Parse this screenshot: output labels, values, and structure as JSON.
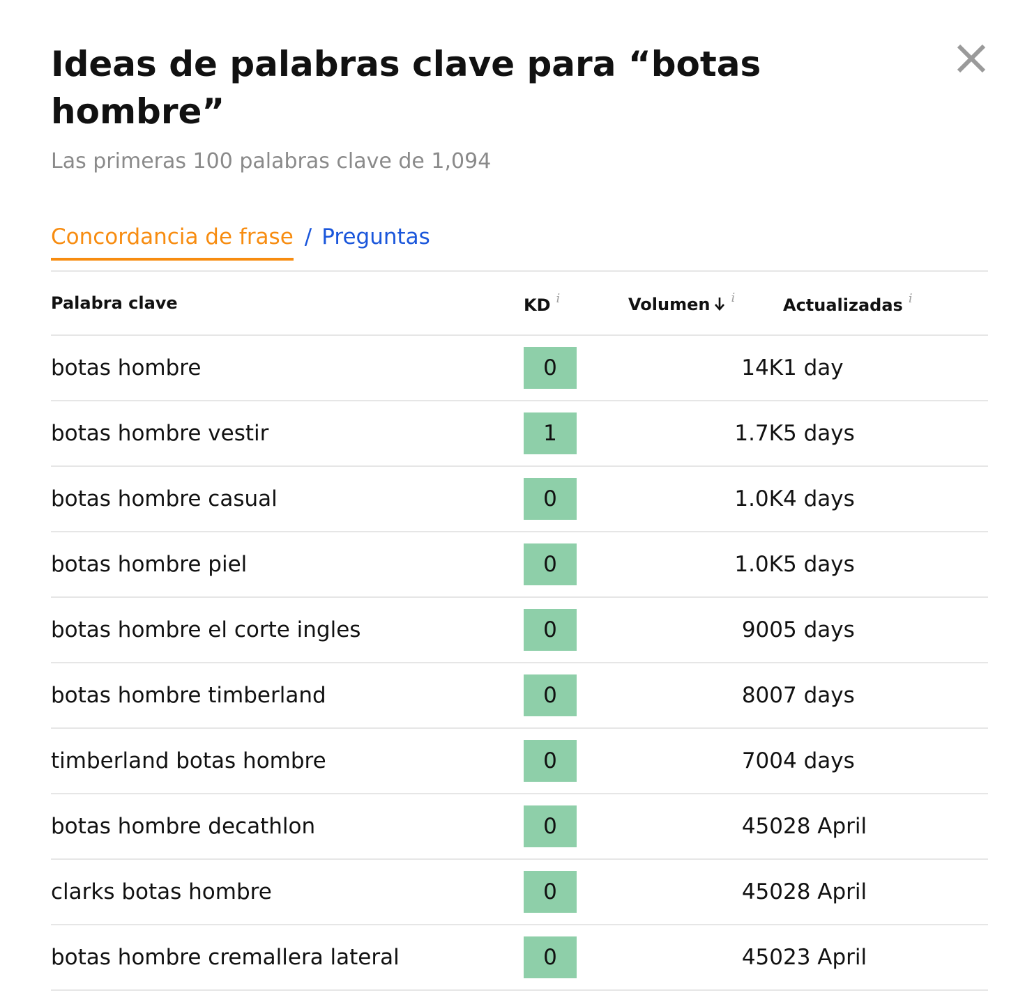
{
  "dialog": {
    "title": "Ideas de palabras clave para “botas hombre”",
    "subtitle": "Las primeras 100 palabras clave de 1,094",
    "close_icon": "close-icon"
  },
  "tabs": {
    "active_label": "Concordancia de frase",
    "separator": "/",
    "other_label": "Preguntas"
  },
  "colors": {
    "active_tab": "#f78c10",
    "link": "#1a56db",
    "kd_badge": "#8ecfa9"
  },
  "table": {
    "headers": {
      "keyword": "Palabra clave",
      "kd": "KD",
      "volume": "Volumen",
      "updated": "Actualizadas",
      "info_glyph": "i"
    },
    "sort": {
      "column": "volume",
      "direction": "descending"
    },
    "rows": [
      {
        "keyword": "botas hombre",
        "kd": "0",
        "volume": "14K",
        "updated": "1 day"
      },
      {
        "keyword": "botas hombre vestir",
        "kd": "1",
        "volume": "1.7K",
        "updated": "5 days"
      },
      {
        "keyword": "botas hombre casual",
        "kd": "0",
        "volume": "1.0K",
        "updated": "4 days"
      },
      {
        "keyword": "botas hombre piel",
        "kd": "0",
        "volume": "1.0K",
        "updated": "5 days"
      },
      {
        "keyword": "botas hombre el corte ingles",
        "kd": "0",
        "volume": "900",
        "updated": "5 days"
      },
      {
        "keyword": "botas hombre timberland",
        "kd": "0",
        "volume": "800",
        "updated": "7 days"
      },
      {
        "keyword": "timberland botas hombre",
        "kd": "0",
        "volume": "700",
        "updated": "4 days"
      },
      {
        "keyword": "botas hombre decathlon",
        "kd": "0",
        "volume": "450",
        "updated": "28 April"
      },
      {
        "keyword": "clarks botas hombre",
        "kd": "0",
        "volume": "450",
        "updated": "28 April"
      },
      {
        "keyword": "botas hombre cremallera lateral",
        "kd": "0",
        "volume": "450",
        "updated": "23 April"
      }
    ]
  }
}
